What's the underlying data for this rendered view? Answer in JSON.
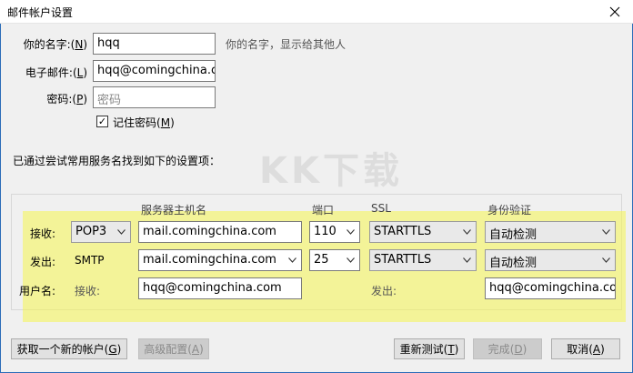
{
  "window": {
    "title": "邮件帐户设置"
  },
  "identity": {
    "name_label": "你的名字:",
    "name_key": "N",
    "name_value": "hqq",
    "name_hint": "你的名字，显示给其他人",
    "email_label": "电子邮件:",
    "email_key": "L",
    "email_value": "hqq@comingchina.co",
    "password_label": "密码:",
    "password_key": "P",
    "password_placeholder": "密码",
    "remember_label": "记住密码",
    "remember_key": "M",
    "remember_checked": true
  },
  "found_message": "已通过尝试常用服务名找到如下的设置项：",
  "watermark": "KK下载",
  "server_table": {
    "headers": {
      "hostname": "服务器主机名",
      "port": "端口",
      "ssl": "SSL",
      "auth": "身份验证"
    },
    "incoming": {
      "label": "接收:",
      "protocol": "POP3",
      "hostname": "mail.comingchina.com",
      "port": "110",
      "ssl": "STARTTLS",
      "auth": "自动检测"
    },
    "outgoing": {
      "label": "发出:",
      "protocol": "SMTP",
      "hostname": "mail.comingchina.com",
      "port": "25",
      "ssl": "STARTTLS",
      "auth": "自动检测"
    },
    "username": {
      "label": "用户名:",
      "incoming_label": "接收:",
      "incoming_value": "hqq@comingchina.com",
      "outgoing_label": "发出:",
      "outgoing_value": "hqq@comingchina.com"
    }
  },
  "buttons": {
    "new_account": "获取一个新的帐户",
    "new_account_key": "G",
    "advanced": "高级配置",
    "advanced_key": "A",
    "retest": "重新测试",
    "retest_key": "T",
    "done": "完成",
    "done_key": "D",
    "cancel": "取消",
    "cancel_key": "A"
  },
  "colors": {
    "highlight": "#f5f550",
    "frame_border": "#2b6cb8",
    "dialog_bg": "#f0f0f0"
  },
  "icons": {
    "close": "close-icon",
    "checkbox": "checkmark-icon",
    "dropdown": "chevron-down-icon"
  }
}
